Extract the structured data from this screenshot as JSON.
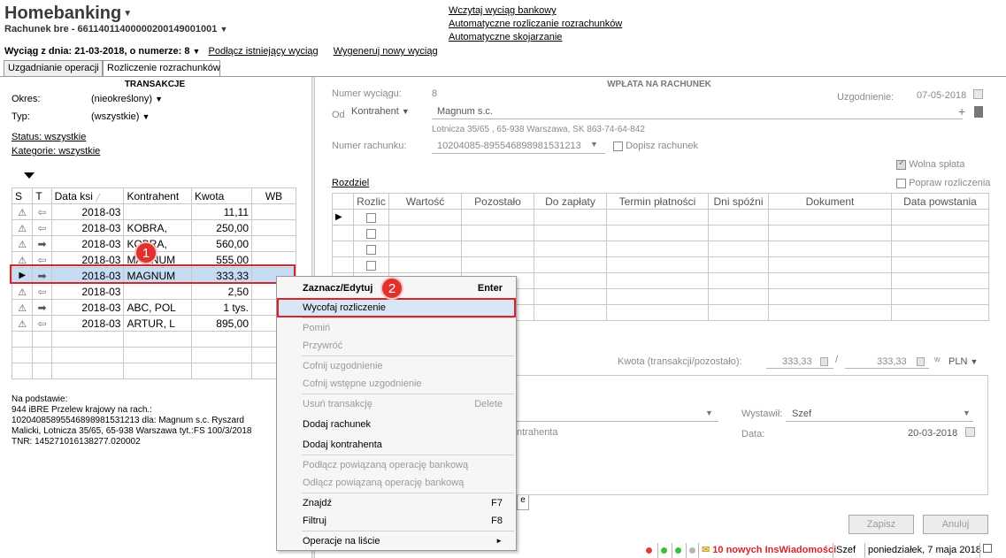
{
  "header": {
    "app_title": "Homebanking",
    "account": "Rachunek bre - 66114011400000200149001001",
    "links": [
      "Wczytaj wyciąg bankowy",
      "Automatyczne rozliczanie rozrachunków",
      "Automatyczne skojarzanie"
    ],
    "statement_text": "Wyciąg z dnia: 21-03-2018, o numerze: 8",
    "attach_link": "Podłącz istniejący wyciąg",
    "generate_link": "Wygeneruj nowy wyciąg"
  },
  "tabs": [
    {
      "label": "Uzgadnianie operacji",
      "active": false
    },
    {
      "label": "Rozliczenie rozrachunków",
      "active": true
    }
  ],
  "left": {
    "title": "TRANSAKCJE",
    "period_label": "Okres:",
    "period_value": "(nieokreślony)",
    "type_label": "Typ:",
    "type_value": "(wszystkie)",
    "status_link": "Status: wszystkie",
    "category_link": "Kategorie: wszystkie",
    "columns": [
      "S",
      "T",
      "Data ksi",
      "Kontrahent",
      "Kwota",
      "WB"
    ],
    "rows": [
      {
        "dir": "in",
        "date": "2018-03",
        "contractor": "",
        "amount": "11,11",
        "selected": false
      },
      {
        "dir": "in",
        "date": "2018-03",
        "contractor": "KOBRA,",
        "amount": "250,00",
        "selected": false
      },
      {
        "dir": "out",
        "date": "2018-03",
        "contractor": "KOBRA,",
        "amount": "560,00",
        "selected": false
      },
      {
        "dir": "in",
        "date": "2018-03",
        "contractor": "MAGNUM",
        "amount": "555,00",
        "selected": false
      },
      {
        "dir": "out",
        "date": "2018-03",
        "contractor": "MAGNUM",
        "amount": "333,33",
        "selected": true
      },
      {
        "dir": "in",
        "date": "2018-03",
        "contractor": "",
        "amount": "2,50",
        "selected": false
      },
      {
        "dir": "out",
        "date": "2018-03",
        "contractor": "ABC, POL",
        "amount": "1 tys.",
        "selected": false
      },
      {
        "dir": "in",
        "date": "2018-03",
        "contractor": "ARTUR, L",
        "amount": "895,00",
        "selected": false
      }
    ],
    "basis_lines": [
      "Na podstawie:",
      "944 iBRE Przelew krajowy  na rach.:",
      "10204085895546898981531213  dla: Magnum s.c. Ryszard",
      "Malicki, Lotnicza 35/65, 65-938 Warszawa  tyt.:FS 100/3/2018",
      "TNR: 145271016138277.020002"
    ]
  },
  "right": {
    "title": "WPŁATA NA RACHUNEK",
    "statement_no_label": "Numer wyciągu:",
    "statement_no_value": "8",
    "reconcile_label": "Uzgodnienie:",
    "reconcile_value": "07-05-2018",
    "from_label": "Od",
    "from_type": "Kontrahent",
    "from_name": "Magnum s.c.",
    "from_address": "Lotnicza  35/65 , 65-938 Warszawa, SK 863-74-64-842",
    "account_label": "Numer rachunku:",
    "account_value": "10204085-895546898981531213",
    "add_account_label": "Dopisz rachunek",
    "free_payment_label": "Wolna spłata",
    "fix_label": "Popraw rozliczenia",
    "split_link": "Rozdziel",
    "split_columns": [
      "Rozlic",
      "Wartość",
      "Pozostało",
      "Do zapłaty",
      "Termin płatności",
      "Dni spóźni",
      "Dokument",
      "Data powstania"
    ],
    "amount_label": "Kwota (transakcji/pozostało):",
    "amount_value": "333,33",
    "remaining_value": "333,33",
    "currency_w": "w",
    "currency": "PLN",
    "issued_label": "Wystawił:",
    "issued_value": "Szef",
    "date_label": "Data:",
    "date_value": "20-03-2018",
    "partial_text": "ntrahenta",
    "save_button": "Zapisz",
    "cancel_button": "Anuluj"
  },
  "context_menu": {
    "items": [
      {
        "label": "Zaznacz/Edytuj",
        "shortcut": "Enter",
        "state": "bold"
      },
      {
        "label": "Wycofaj rozliczenie",
        "shortcut": "",
        "state": "highlight"
      },
      {
        "label": "Pomiń",
        "shortcut": "",
        "state": "disabled"
      },
      {
        "label": "Przywróć",
        "shortcut": "",
        "state": "disabled"
      },
      {
        "label": "Cofnij uzgodnienie",
        "shortcut": "",
        "state": "disabled"
      },
      {
        "label": "Cofnij wstępne uzgodnienie",
        "shortcut": "",
        "state": "disabled"
      },
      {
        "label": "Usuń transakcję",
        "shortcut": "Delete",
        "state": "disabled"
      },
      {
        "label": "Dodaj rachunek",
        "shortcut": "",
        "state": "normal"
      },
      {
        "label": "Dodaj kontrahenta",
        "shortcut": "",
        "state": "normal"
      },
      {
        "label": "Podłącz powiązaną operację bankową",
        "shortcut": "",
        "state": "disabled"
      },
      {
        "label": "Odłącz powiązaną operację bankową",
        "shortcut": "",
        "state": "disabled"
      },
      {
        "label": "Znajdź",
        "shortcut": "F7",
        "state": "normal"
      },
      {
        "label": "Filtruj",
        "shortcut": "F8",
        "state": "normal"
      },
      {
        "label": "Operacje na liście",
        "shortcut": "►",
        "state": "normal"
      }
    ]
  },
  "badges": [
    "1",
    "2"
  ],
  "statusbar": {
    "messages": "10 nowych InsWiadomości",
    "user": "Szef",
    "date": "poniedziałek, 7 maja 2018"
  }
}
